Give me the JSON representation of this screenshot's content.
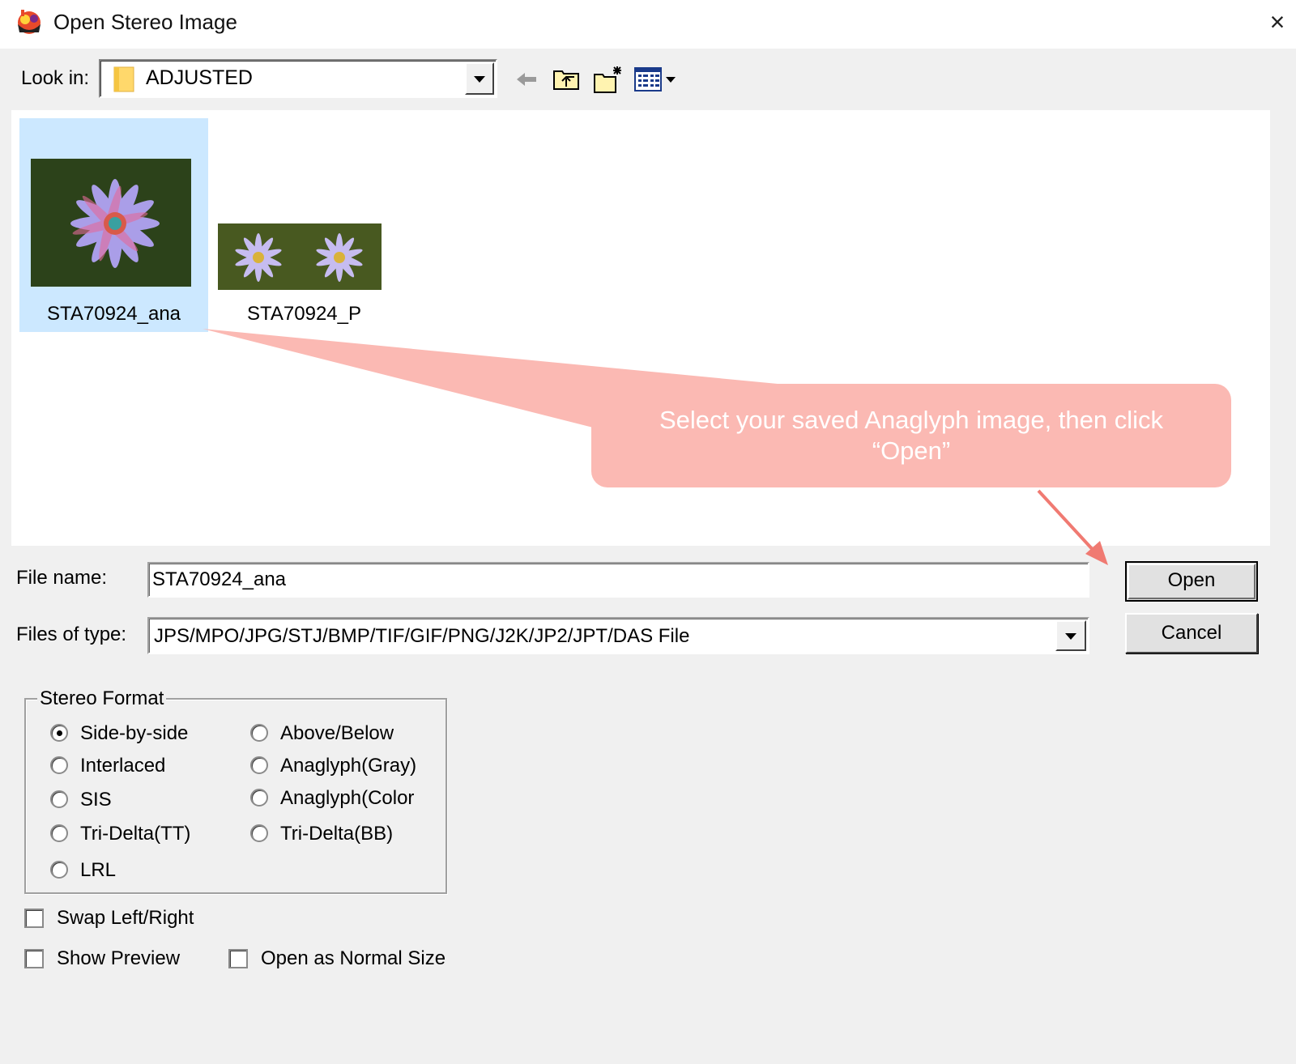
{
  "window": {
    "title": "Open Stereo Image",
    "close_symbol": "×"
  },
  "lookin": {
    "label": "Look in:",
    "value": "ADJUSTED"
  },
  "toolbar": {
    "icons": [
      "back-arrow-icon",
      "up-folder-icon",
      "new-folder-icon",
      "views-menu-icon"
    ]
  },
  "files": [
    {
      "name": "STA70924_ana",
      "selected": true
    },
    {
      "name": "STA70924_P",
      "selected": false
    }
  ],
  "callout": {
    "text": "Select your saved Anaglyph image, then click “Open”",
    "color": "#fbb9b3"
  },
  "filename": {
    "label": "File name:",
    "value": "STA70924_ana"
  },
  "filetype": {
    "label": "Files of type:",
    "value": "JPS/MPO/JPG/STJ/BMP/TIF/GIF/PNG/J2K/JP2/JPT/DAS File"
  },
  "buttons": {
    "open": "Open",
    "cancel": "Cancel"
  },
  "stereo_format": {
    "label": "Stereo Format",
    "options": [
      {
        "label": "Side-by-side",
        "checked": true
      },
      {
        "label": "Above/Below",
        "checked": false
      },
      {
        "label": "Interlaced",
        "checked": false
      },
      {
        "label": "Anaglyph(Gray)",
        "checked": false
      },
      {
        "label": "SIS",
        "checked": false
      },
      {
        "label": "Anaglyph(Color",
        "checked": false
      },
      {
        "label": "Tri-Delta(TT)",
        "checked": false
      },
      {
        "label": "Tri-Delta(BB)",
        "checked": false
      },
      {
        "label": "LRL",
        "checked": false
      }
    ]
  },
  "checkboxes": {
    "swap": {
      "label": "Swap Left/Right",
      "checked": false
    },
    "preview": {
      "label": "Show Preview",
      "checked": false
    },
    "normal_size": {
      "label": "Open as Normal Size",
      "checked": false
    }
  },
  "colors": {
    "selection": "#cce8ff",
    "dialog_bg": "#f0f0f0"
  }
}
